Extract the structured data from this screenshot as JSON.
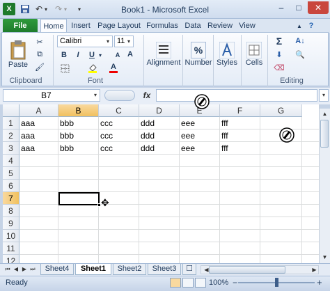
{
  "window": {
    "title": "Book1 - Microsoft Excel",
    "minimize": "–",
    "maximize": "□",
    "close": "✕"
  },
  "qat": {
    "save": "💾",
    "undo": "↶",
    "redo": "↷",
    "more": "▾"
  },
  "ribbon": {
    "file_tab": "File",
    "tabs": [
      "Home",
      "Insert",
      "Page Layout",
      "Formulas",
      "Data",
      "Review",
      "View"
    ],
    "groups": {
      "clipboard": {
        "label": "Clipboard",
        "paste": "Paste"
      },
      "font": {
        "label": "Font",
        "font_name": "Calibri",
        "font_size": "11",
        "bold": "B",
        "italic": "I",
        "underline": "U",
        "grow": "A",
        "shrink": "A"
      },
      "alignment": {
        "label": "Alignment"
      },
      "number": {
        "label": "Number",
        "symbol": "%"
      },
      "styles": {
        "label": "Styles"
      },
      "cells": {
        "label": "Cells"
      },
      "editing": {
        "label": "Editing",
        "sum": "Σ"
      }
    }
  },
  "formula_bar": {
    "name_box": "B7",
    "fx": "fx",
    "formula": ""
  },
  "grid": {
    "columns": [
      "A",
      "B",
      "C",
      "D",
      "E",
      "F",
      "G"
    ],
    "rows": [
      "1",
      "2",
      "3",
      "4",
      "5",
      "6",
      "7",
      "8",
      "9",
      "10",
      "11",
      "12"
    ],
    "cells": [
      [
        "aaa",
        "bbb",
        "ccc",
        "ddd",
        "eee",
        "fff"
      ],
      [
        "aaa",
        "bbb",
        "ccc",
        "ddd",
        "eee",
        "fff"
      ],
      [
        "aaa",
        "bbb",
        "ccc",
        "ddd",
        "eee",
        "fff"
      ]
    ],
    "selected_column": "B",
    "selected_row": "7"
  },
  "sheets": {
    "tabs": [
      "Sheet4",
      "Sheet1",
      "Sheet2",
      "Sheet3"
    ],
    "active": "Sheet1",
    "nav": [
      "⏮",
      "◀",
      "▶",
      "⏭"
    ]
  },
  "status": {
    "text": "Ready",
    "zoom": "100%",
    "zoom_minus": "−",
    "zoom_plus": "+"
  },
  "icons": {
    "excel_logo": "excel-logo-icon",
    "cursor": "move-cursor-icon",
    "clock": "busy-pen-icon"
  }
}
